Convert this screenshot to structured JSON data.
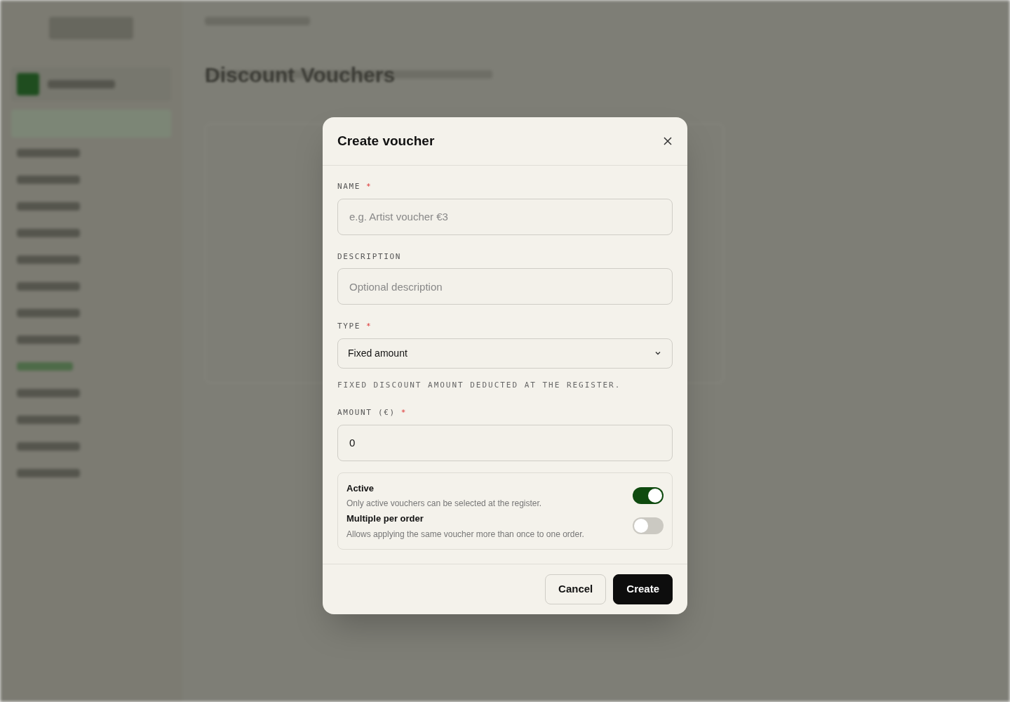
{
  "page": {
    "title": "Discount Vouchers"
  },
  "dialog": {
    "title": "Create voucher",
    "fields": [
      {
        "kind": "text",
        "label": "NAME",
        "required_mark": "*",
        "placeholder": "e.g. Artist voucher €3"
      },
      {
        "kind": "text",
        "label": "DESCRIPTION",
        "placeholder": "Optional description"
      },
      {
        "kind": "select",
        "label": "TYPE",
        "required_mark": "*",
        "value": "Fixed amount",
        "hint": "FIXED DISCOUNT AMOUNT DEDUCTED AT THE REGISTER."
      },
      {
        "kind": "text",
        "label": "AMOUNT (€)",
        "required_mark": "*",
        "value": "0"
      }
    ],
    "toggles": [
      {
        "label": "Active",
        "description": "Only active vouchers can be selected at the register.",
        "on": true
      },
      {
        "label": "Multiple per order",
        "description": "Allows applying the same voucher more than once to one order.",
        "on": false
      }
    ],
    "buttons": [
      {
        "kind": "secondary",
        "label": "Cancel"
      },
      {
        "kind": "primary",
        "label": "Create"
      }
    ]
  }
}
